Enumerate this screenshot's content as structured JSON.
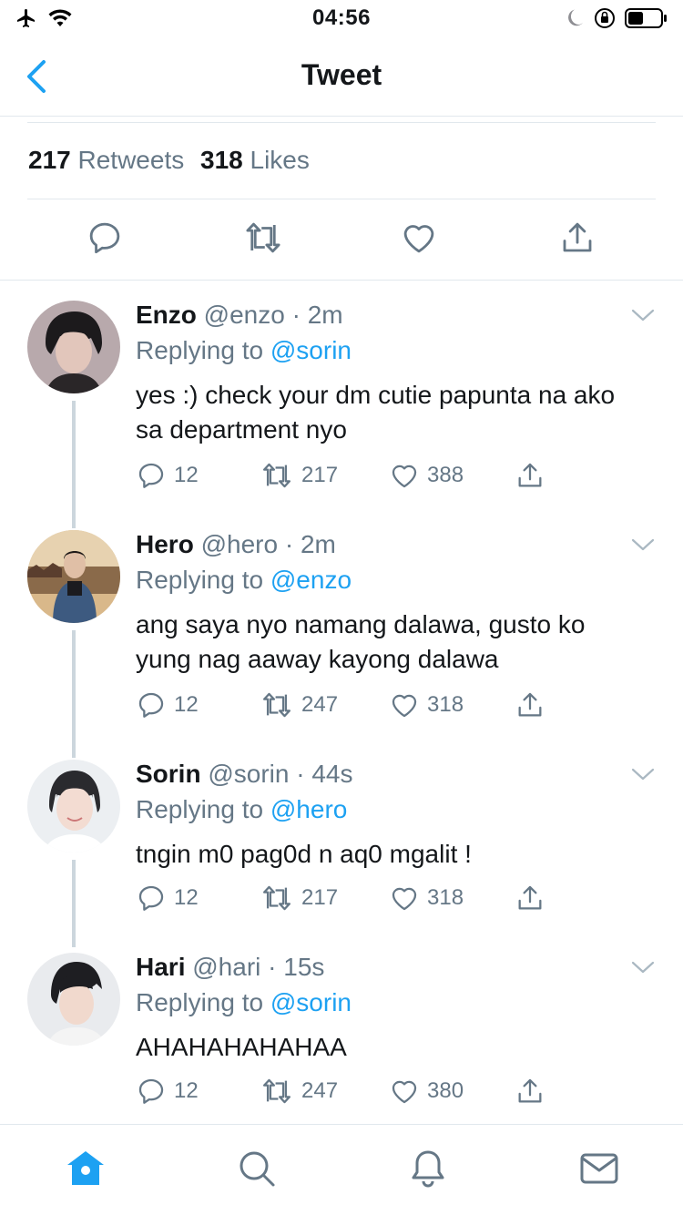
{
  "status_bar": {
    "time": "04:56",
    "icons": [
      "airplane-icon",
      "wifi-icon",
      "moon-icon",
      "orientation-lock-icon",
      "battery-icon"
    ]
  },
  "nav": {
    "title": "Tweet",
    "back_icon": "chevron-left-icon"
  },
  "tweet_stats": {
    "retweets_count": "217",
    "retweets_label": "Retweets",
    "likes_count": "318",
    "likes_label": "Likes"
  },
  "tweet_actions": [
    "reply-icon",
    "retweet-icon",
    "like-icon",
    "share-icon"
  ],
  "replies": [
    {
      "name": "Enzo",
      "handle": "@enzo",
      "time": "2m",
      "replying_prefix": "Replying to",
      "replying_to": "@sorin",
      "text": "yes :) check your dm cutie papunta na ako sa department nyo",
      "replies": "12",
      "retweets": "217",
      "likes": "388"
    },
    {
      "name": "Hero",
      "handle": "@hero",
      "time": "2m",
      "replying_prefix": "Replying to",
      "replying_to": "@enzo",
      "text": "ang saya nyo namang dalawa, gusto ko yung nag aaway kayong dalawa",
      "replies": "12",
      "retweets": "247",
      "likes": "318"
    },
    {
      "name": "Sorin",
      "handle": "@sorin",
      "time": "44s",
      "replying_prefix": "Replying to",
      "replying_to": "@hero",
      "text": "tngin m0 pag0d n aq0 mgalit !",
      "replies": "12",
      "retweets": "217",
      "likes": "318"
    },
    {
      "name": "Hari",
      "handle": "@hari",
      "time": "15s",
      "replying_prefix": "Replying to",
      "replying_to": "@sorin",
      "text": "AHAHAHAHAHAA",
      "replies": "12",
      "retweets": "247",
      "likes": "380"
    }
  ],
  "tab_bar": [
    "home-icon",
    "search-icon",
    "notifications-icon",
    "messages-icon"
  ],
  "colors": {
    "accent": "#1da1f2",
    "text_primary": "#14171a",
    "text_secondary": "#657786",
    "divider": "#e1e8ed"
  }
}
